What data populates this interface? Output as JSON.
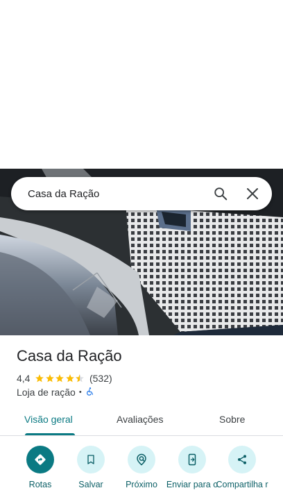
{
  "search": {
    "query": "Casa da Ração"
  },
  "place": {
    "name": "Casa da Ração",
    "rating": "4,4",
    "rating_value": 4.4,
    "review_count": "(532)",
    "category": "Loja de ração",
    "separator": "•"
  },
  "tabs": [
    {
      "label": "Visão geral",
      "active": true
    },
    {
      "label": "Avaliações",
      "active": false
    },
    {
      "label": "Sobre",
      "active": false
    }
  ],
  "actions": [
    {
      "label": "Rotas",
      "icon": "directions-icon"
    },
    {
      "label": "Salvar",
      "icon": "bookmark-icon"
    },
    {
      "label": "Próximo",
      "icon": "nearby-icon"
    },
    {
      "label": "Enviar para o",
      "icon": "send-to-phone-icon"
    },
    {
      "label": "Compartilha r",
      "icon": "share-icon"
    }
  ],
  "colors": {
    "accent": "#0b7a83",
    "star": "#fbbc04",
    "chip": "#d6f3f6"
  }
}
